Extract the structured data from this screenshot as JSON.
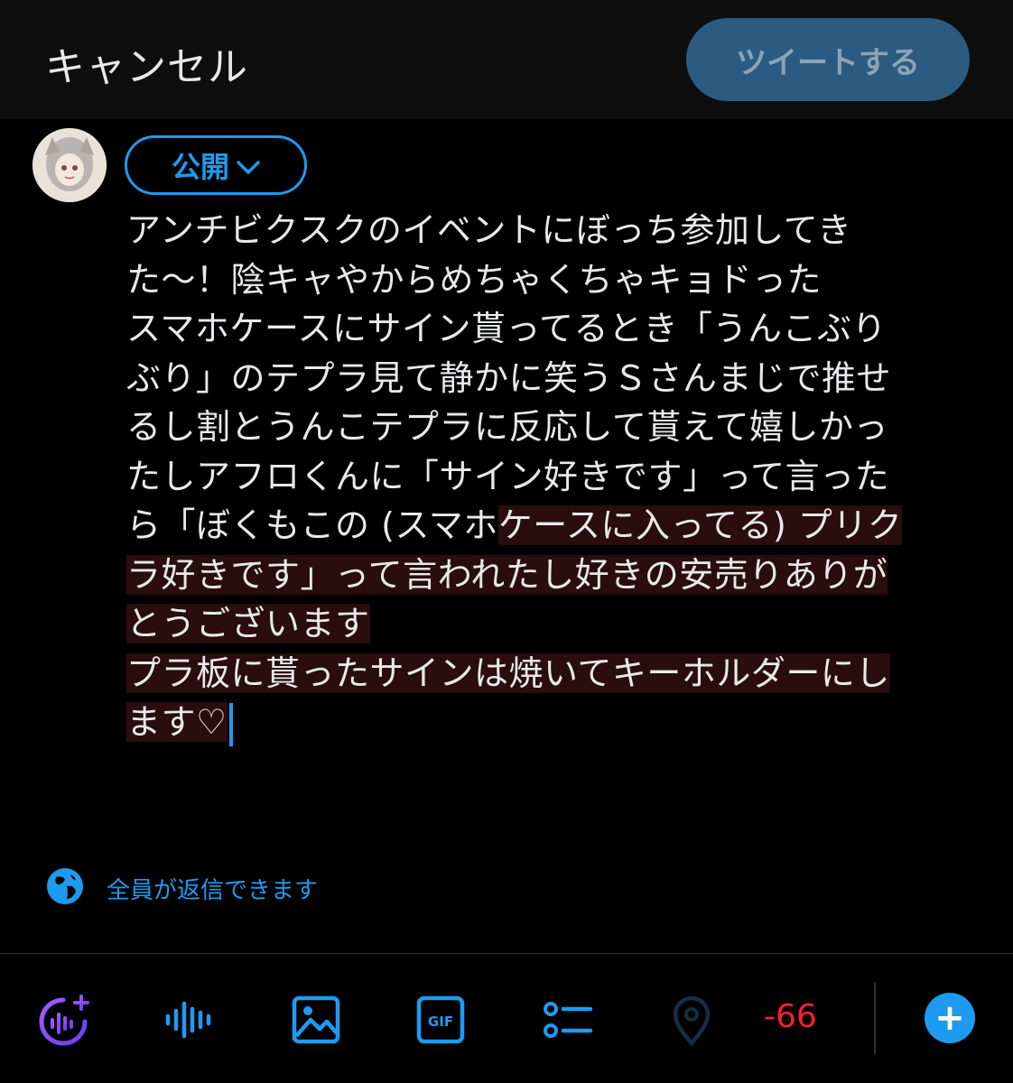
{
  "header": {
    "cancel_label": "キャンセル",
    "tweet_label": "ツイートする"
  },
  "composer": {
    "audience_label": "公開",
    "lines": [
      "アンチビクスクのイベントにぼっち参加してき",
      "た〜！陰キャやからめちゃくちゃキョドった",
      "スマホケースにサイン貰ってるとき「うんこぶり",
      "ぶり」のテプラ見て静かに笑うＳさんまじで推せ",
      "るし割とうんこテプラに反応して貰えて嬉しかっ",
      "たしアフロくんに「サイン好きです」って言った"
    ],
    "line7_plain": "ら「ぼくもこの (スマホ",
    "line7_selected": "ケースに入ってる) プリク",
    "selected_lines": [
      "ラ好きです」って言われたし好きの安売りありが",
      "とうございます",
      "プラ板に貰ったサインは焼いてキーホルダーにし",
      "ます♡"
    ]
  },
  "reply_setting": {
    "label": "全員が返信できます",
    "icon": "globe-icon"
  },
  "toolbar": {
    "char_count": "-66",
    "icons": [
      "spaces-icon",
      "audio-icon",
      "image-icon",
      "gif-icon",
      "poll-icon",
      "location-icon",
      "add-tweet-icon"
    ]
  },
  "colors": {
    "accent": "#1d9bf0",
    "warning": "#f4212e",
    "selection": "#2a0d0f"
  }
}
